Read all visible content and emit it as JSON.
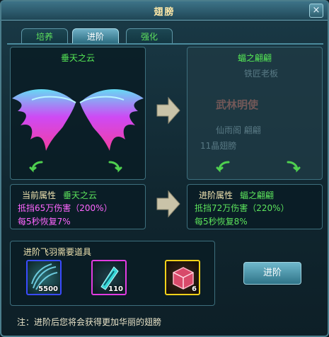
{
  "window": {
    "title": "翅膀",
    "close_label": "×"
  },
  "tabs": [
    {
      "label": "培养",
      "active": false
    },
    {
      "label": "进阶",
      "active": true
    },
    {
      "label": "强化",
      "active": false
    }
  ],
  "current": {
    "wing_name": "垂天之云",
    "attr_label": "当前属性",
    "attr_name": "垂天之云",
    "line1": "抵挡65万伤害（200%）",
    "line2": "每5秒恢复7%"
  },
  "next": {
    "wing_name": "蝠之翩翩",
    "attr_label": "进阶属性",
    "attr_name": "蝠之翩翩",
    "line1": "抵挡72万伤害（220%）",
    "line2": "每5秒恢复8%",
    "ghost_text": [
      "铁匠老板",
      "武林明使",
      "仙雨阁 翩翩",
      "11晶翅膀"
    ]
  },
  "requirements": {
    "title": "进阶飞羽需要道具",
    "items": [
      {
        "name": "feather-bundle-item",
        "count": "5500",
        "border": "#3a4bff"
      },
      {
        "name": "crystal-feather-item",
        "count": "110",
        "border": "#e23ce2"
      },
      {
        "name": "treasure-box-item",
        "count": "6",
        "border": "#f5d21a"
      }
    ]
  },
  "advance_button": "进阶",
  "note": "注：进阶后您将会获得更加华丽的翅膀",
  "colors": {
    "accent_green": "#5ce35c",
    "pink": "#ff66ff",
    "title_gold": "#ffe9a8"
  }
}
